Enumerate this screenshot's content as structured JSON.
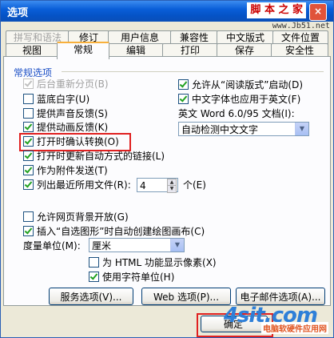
{
  "window": {
    "title": "选项",
    "close_symbol": "×"
  },
  "watermark": {
    "text": "脚 本 之 家",
    "url": "www.Jb51.net"
  },
  "tabs_row1": [
    "拼写和语法",
    "修订",
    "用户信息",
    "兼容性",
    "中文版式",
    "文件位置"
  ],
  "tabs_row2": [
    "视图",
    "常规",
    "编辑",
    "打印",
    "保存",
    "安全性"
  ],
  "active_tab": "常规",
  "group": {
    "title": "常规选项"
  },
  "options_left": [
    {
      "label": "后台重新分页(B)",
      "checked": true,
      "disabled": true
    },
    {
      "label": "蓝底白字(U)",
      "checked": false
    },
    {
      "label": "提供声音反馈(S)",
      "checked": false
    },
    {
      "label": "提供动画反馈(K)",
      "checked": true
    },
    {
      "label": "打开时确认转换(O)",
      "checked": true
    },
    {
      "label": "打开时更新自动方式的链接(L)",
      "checked": true
    },
    {
      "label": "作为附件发送(T)",
      "checked": true
    },
    {
      "label": "列出最近所用文件(R):",
      "checked": true
    }
  ],
  "recent_files": {
    "value": "4",
    "unit": "个(E)"
  },
  "options_right": [
    {
      "label": "允许从“阅读版式”启动(D)",
      "checked": true
    },
    {
      "label": "中文字体也应用于英文(F)",
      "checked": true
    }
  ],
  "word_doc": {
    "label": "英文 Word 6.0/95 文档(I):",
    "value": "自动检测中文文字"
  },
  "options_bottom": [
    {
      "label": "允许网页背景开放(G)",
      "checked": false
    },
    {
      "label": "插入“自选图形”时自动创建绘图画布(C)",
      "checked": true
    }
  ],
  "measure": {
    "label": "度量单位(M):",
    "value": "厘米"
  },
  "options_measure": [
    {
      "label": "为 HTML 功能显示像素(X)",
      "checked": false
    },
    {
      "label": "使用字符单位(H)",
      "checked": true
    }
  ],
  "buttons": {
    "service": "服务选项(V)...",
    "web": "Web 选项(P)...",
    "email": "电子邮件选项(A)...",
    "ok": "确定"
  },
  "logo": {
    "brand": "4sit.com",
    "tagline": "电脑软硬件应用网"
  },
  "colors": {
    "title_bar": "#0a5fd8",
    "group_title": "#1d50c6",
    "highlight": "#e02020"
  }
}
